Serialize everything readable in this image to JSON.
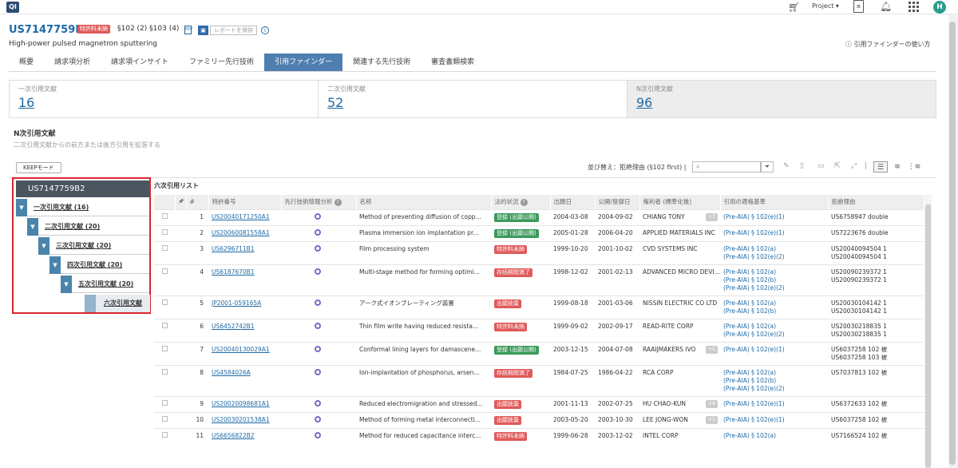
{
  "app": {
    "logo": "QI",
    "project_label": "Project ▾",
    "avatar": "H"
  },
  "header": {
    "patent_number": "US7147759B2",
    "status_badge": "特許料未納",
    "sections": "§102 (2) §103 (4)",
    "pdf_icon": "PDF",
    "save_label": "レポートを保存",
    "subtitle": "High-power pulsed magnetron sputtering",
    "help_link": "ⓘ 引用ファインダーの使い方"
  },
  "tabs": [
    "概要",
    "請求項分析",
    "請求項インサイト",
    "ファミリー先行技術",
    "引用ファインダー",
    "関連する先行技術",
    "審査書類検索"
  ],
  "active_tab": "引用ファインダー",
  "counts": [
    {
      "label": "一次引用文献",
      "value": "16"
    },
    {
      "label": "二次引用文献",
      "value": "52"
    },
    {
      "label": "N次引用文献",
      "value": "96"
    }
  ],
  "section": {
    "title": "N次引用文献",
    "subtitle": "二次引用文献からの前方または後方引用を拡張する",
    "keep_button": "KEEPモード",
    "list_title": "六次引用リスト"
  },
  "toolbar": {
    "sort_label": "並び替え：拒絶理由 (§102 first)  |",
    "search_placeholder": "",
    "filter_icon": "⏷",
    "separator": "|"
  },
  "tree": {
    "root": "US7147759B2",
    "levels": [
      {
        "label": "一次引用文献",
        "count": "(16)"
      },
      {
        "label": "二次引用文献",
        "count": "(20)"
      },
      {
        "label": "三次引用文献",
        "count": "(20)"
      },
      {
        "label": "四次引用文献",
        "count": "(20)"
      },
      {
        "label": "五次引用文献",
        "count": "(20)"
      }
    ],
    "leaf": "六次引用文献"
  },
  "table": {
    "headers": [
      "",
      "🖈",
      "#",
      "特許番号",
      "先行技術情報分析",
      "名称",
      "法的状況",
      "出願日",
      "公開/登録日",
      "権利者 (標準化後)",
      "引用の適格基準",
      "拒絶理由"
    ],
    "rows": [
      {
        "n": "1",
        "pat": "US20040171250A1",
        "title": "Method of preventing diffusion of copp...",
        "status": "登録 (出願公開)",
        "sc": "green",
        "filed": "2004-03-08",
        "pub": "2004-09-02",
        "owner": "CHIANG TONY",
        "more": "+7",
        "basis": [
          "(Pre-AIA) § 102(e)(1)"
        ],
        "reason": [
          "US6758947 double"
        ]
      },
      {
        "n": "2",
        "pat": "US20060081558A1",
        "title": "Plasma immersion ion implantation pr...",
        "status": "登録 (出願公開)",
        "sc": "green",
        "filed": "2005-01-28",
        "pub": "2006-04-20",
        "owner": "APPLIED MATERIALS INC",
        "more": "",
        "basis": [
          "(Pre-AIA) § 102(e)(1)"
        ],
        "reason": [
          "US7223676 double"
        ]
      },
      {
        "n": "3",
        "pat": "US6296711B1",
        "title": "Film processing system",
        "status": "特許料未納",
        "sc": "red",
        "filed": "1999-10-20",
        "pub": "2001-10-02",
        "owner": "CVD SYSTEMS INC",
        "more": "",
        "basis": [
          "(Pre-AIA) § 102(a)",
          "(Pre-AIA) § 102(e)(2)"
        ],
        "reason": [
          "US20040094504 1",
          "US20040094504 1"
        ]
      },
      {
        "n": "4",
        "pat": "US6187670B1",
        "title": "Multi-stage method for forming optimi...",
        "status": "存続期間満了",
        "sc": "red",
        "filed": "1998-12-02",
        "pub": "2001-02-13",
        "owner": "ADVANCED MICRO DEVI...",
        "more": "",
        "basis": [
          "(Pre-AIA) § 102(a)",
          "(Pre-AIA) § 102(b)",
          "(Pre-AIA) § 102(e)(2)"
        ],
        "reason": [
          "US20090239372 1",
          "US20090239372 1"
        ]
      },
      {
        "n": "5",
        "pat": "JP2001-059165A",
        "title": "アーク式イオンプレーティング装置",
        "status": "出願放棄",
        "sc": "red",
        "filed": "1999-08-18",
        "pub": "2001-03-06",
        "owner": "NISSIN ELECTRIC CO LTD",
        "more": "",
        "basis": [
          "(Pre-AIA) § 102(a)",
          "(Pre-AIA) § 102(b)"
        ],
        "reason": [
          "US20030104142 1",
          "US20030104142 1"
        ]
      },
      {
        "n": "6",
        "pat": "US6452742B1",
        "title": "Thin film write having reduced resista...",
        "status": "特許料未納",
        "sc": "red",
        "filed": "1999-09-02",
        "pub": "2002-09-17",
        "owner": "READ-RITE CORP",
        "more": "",
        "basis": [
          "(Pre-AIA) § 102(a)",
          "(Pre-AIA) § 102(e)(2)"
        ],
        "reason": [
          "US20030218835 1",
          "US20030218835 1"
        ]
      },
      {
        "n": "7",
        "pat": "US20040130029A1",
        "title": "Conformal lining layers for damascene...",
        "status": "登録 (出願公開)",
        "sc": "green",
        "filed": "2003-12-15",
        "pub": "2004-07-08",
        "owner": "RAAIJMAKERS IVO",
        "more": "+5",
        "basis": [
          "(Pre-AIA) § 102(e)(1)"
        ],
        "reason": [
          "US6037258 102 被",
          "US6037258 103 被"
        ]
      },
      {
        "n": "8",
        "pat": "US4584026A",
        "title": "Ion-implantation of phosphorus, arsen...",
        "status": "存続期間満了",
        "sc": "red",
        "filed": "1984-07-25",
        "pub": "1986-04-22",
        "owner": "RCA CORP",
        "more": "",
        "basis": [
          "(Pre-AIA) § 102(a)",
          "(Pre-AIA) § 102(b)",
          "(Pre-AIA) § 102(e)(2)"
        ],
        "reason": [
          "US7037813 102 被"
        ]
      },
      {
        "n": "9",
        "pat": "US20020098681A1",
        "title": "Reduced electromigration and stressed...",
        "status": "出願放棄",
        "sc": "red",
        "filed": "2001-11-13",
        "pub": "2002-07-25",
        "owner": "HU CHAO-KUN",
        "more": "+4",
        "basis": [
          "(Pre-AIA) § 102(e)(1)"
        ],
        "reason": [
          "US6372633 102 被"
        ]
      },
      {
        "n": "10",
        "pat": "US20030201538A1",
        "title": "Method of forming metal interconnecti...",
        "status": "出願放棄",
        "sc": "red",
        "filed": "2003-05-20",
        "pub": "2003-10-30",
        "owner": "LEE JONG-WON",
        "more": "+3",
        "basis": [
          "(Pre-AIA) § 102(e)(1)"
        ],
        "reason": [
          "US6037258 102 被"
        ]
      },
      {
        "n": "11",
        "pat": "US6656822B2",
        "title": "Method for reduced capacitance interc...",
        "status": "特許料未納",
        "sc": "red",
        "filed": "1999-06-28",
        "pub": "2003-12-02",
        "owner": "INTEL CORP",
        "more": "",
        "basis": [
          "(Pre-AIA) § 102(a)"
        ],
        "reason": [
          "US7166524 102 被"
        ]
      }
    ]
  }
}
